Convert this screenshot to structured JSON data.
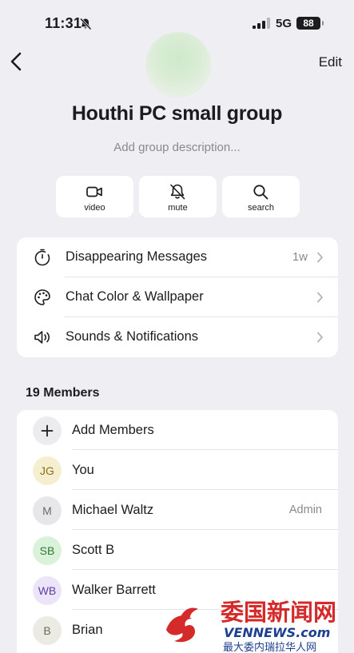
{
  "status_bar": {
    "time": "11:31",
    "network": "5G",
    "battery": "88"
  },
  "nav": {
    "edit_label": "Edit"
  },
  "group": {
    "title": "Houthi PC small group",
    "description_placeholder": "Add group description..."
  },
  "actions": [
    {
      "label": "video",
      "icon": "video-camera-icon"
    },
    {
      "label": "mute",
      "icon": "bell-slash-icon"
    },
    {
      "label": "search",
      "icon": "magnifier-icon"
    }
  ],
  "settings": [
    {
      "label": "Disappearing Messages",
      "value": "1w",
      "icon": "timer-icon"
    },
    {
      "label": "Chat Color & Wallpaper",
      "value": "",
      "icon": "palette-icon"
    },
    {
      "label": "Sounds & Notifications",
      "value": "",
      "icon": "speaker-icon"
    }
  ],
  "members_title": "19 Members",
  "members": {
    "add_label": "Add Members",
    "list": [
      {
        "initials": "JG",
        "name": "You",
        "role": "",
        "bg": "#f6efcf",
        "fg": "#8a6d1b"
      },
      {
        "initials": "M",
        "name": "Michael Waltz",
        "role": "Admin",
        "bg": "#e7e7e9",
        "fg": "#6b6b70"
      },
      {
        "initials": "SB",
        "name": "Scott B",
        "role": "",
        "bg": "#d9f2d9",
        "fg": "#2f7a36"
      },
      {
        "initials": "WB",
        "name": "Walker Barrett",
        "role": "",
        "bg": "#ece4f9",
        "fg": "#5b3fa0"
      },
      {
        "initials": "B",
        "name": "Brian",
        "role": "",
        "bg": "#ecebe3",
        "fg": "#6b6a5c"
      }
    ]
  },
  "watermark": {
    "brand": "委国新闻网",
    "domain": "VENNEWS.com",
    "tagline": "最大委内瑞拉华人网"
  },
  "colors": {
    "background": "#efeff3",
    "card": "#ffffff",
    "secondary_text": "#8a8a8e",
    "watermark_red": "#d42a2a",
    "watermark_blue": "#1d3f8f"
  }
}
